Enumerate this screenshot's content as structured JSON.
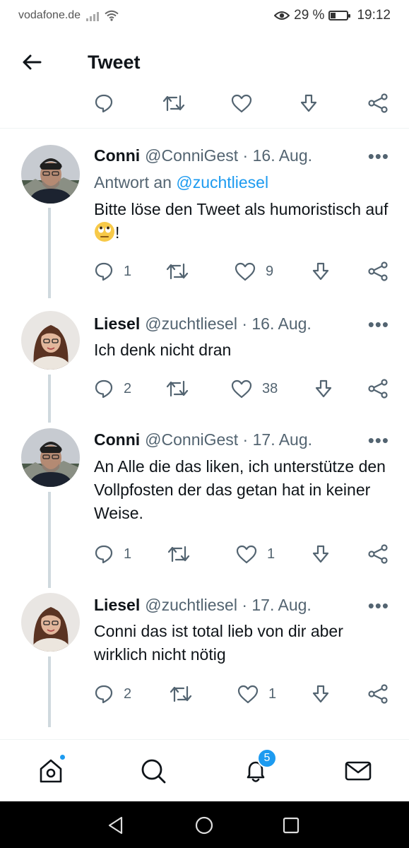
{
  "status_bar": {
    "carrier": "vodafone.de",
    "battery_percent": "29 %",
    "battery_level": 0.29,
    "time": "19:12"
  },
  "header": {
    "title": "Tweet",
    "back_icon": "arrow-left-icon"
  },
  "top_actions": {
    "icons": [
      "reply-icon",
      "retweet-icon",
      "like-icon",
      "download-icon",
      "share-icon"
    ]
  },
  "tweets": [
    {
      "name": "Conni",
      "meta": "@ConniGest · 16. Aug.",
      "more": "•••",
      "reply_prefix": "Antwort an",
      "reply_mention": "@zuchtliesel",
      "text_before_emoji": "Bitte löse den Tweet als humoristisch auf",
      "emoji": "face-with-rolling-eyes",
      "text_after_emoji": "!",
      "replies": "1",
      "retweets": "",
      "likes": "9"
    },
    {
      "name": "Liesel",
      "meta": "@zuchtliesel · 16. Aug.",
      "more": "•••",
      "text": "Ich denk nicht dran",
      "replies": "2",
      "retweets": "",
      "likes": "38"
    },
    {
      "name": "Conni",
      "meta": "@ConniGest · 17. Aug.",
      "more": "•••",
      "text": "An Alle die das liken, ich unterstütze den Vollpfosten der das getan hat in keiner Weise.",
      "replies": "1",
      "retweets": "",
      "likes": "1"
    },
    {
      "name": "Liesel",
      "meta": "@zuchtliesel · 17. Aug.",
      "more": "•••",
      "text": "Conni das ist total lieb von dir aber wirklich nicht nötig",
      "replies": "2",
      "retweets": "",
      "likes": "1"
    }
  ],
  "bottom_nav": {
    "items": [
      "home-icon",
      "search-icon",
      "notifications-icon",
      "messages-icon"
    ],
    "notifications_badge": "5"
  },
  "system_nav": {
    "items": [
      "back-triangle-icon",
      "home-circle-icon",
      "recents-square-icon"
    ]
  },
  "colors": {
    "accent": "#1d9bf0",
    "text_primary": "#0f1419",
    "text_secondary": "#536471",
    "thread_line": "#cfd9de"
  }
}
